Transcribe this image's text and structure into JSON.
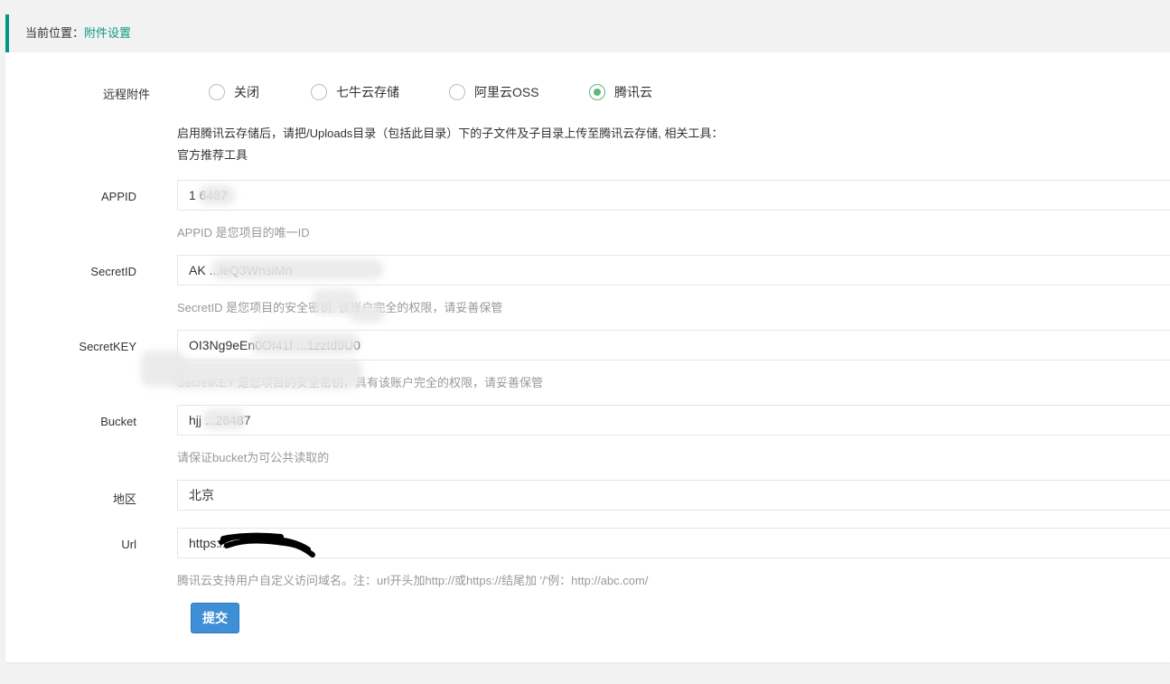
{
  "breadcrumb": {
    "prefix": "当前位置：",
    "current": "附件设置"
  },
  "form": {
    "remote_label": "远程附件",
    "options": [
      {
        "label": "关闭",
        "checked": false
      },
      {
        "label": "七牛云存储",
        "checked": false
      },
      {
        "label": "阿里云OSS",
        "checked": false
      },
      {
        "label": "腾讯云",
        "checked": true
      }
    ],
    "notice_line1": "启用腾讯云存储后，请把/Uploads目录（包括此目录）下的子文件及子目录上传至腾讯云存储, 相关工具：",
    "notice_line2": "官方推荐工具",
    "appid": {
      "label": "APPID",
      "value": "1 6487",
      "help": "APPID 是您项目的唯一ID"
    },
    "secretid": {
      "label": "SecretID",
      "value": "AK ...ieQ3WnsiMn",
      "help": "SecretID 是您项目的安全密钥, 该账户完全的权限，请妥善保管"
    },
    "secretkey": {
      "label": "SecretKEY",
      "value": "OI3Ng9eEn0OI41f ...1zztd9U0",
      "help": "SecretKEY 是您项目的安全密钥，具有该账户完全的权限，请妥善保管"
    },
    "bucket": {
      "label": "Bucket",
      "value": "hjj ...26487",
      "help": "请保证bucket为可公共读取的"
    },
    "region": {
      "label": "地区",
      "value": "北京"
    },
    "url": {
      "label": "Url",
      "value": "https://",
      "help": "腾讯云支持用户自定义访问域名。注：url开头加http://或https://结尾加 '/'例：http://abc.com/"
    },
    "submit_label": "提交"
  },
  "colors": {
    "accent": "#009688",
    "radio_checked": "#5fb878",
    "button": "#3f8fd7"
  }
}
